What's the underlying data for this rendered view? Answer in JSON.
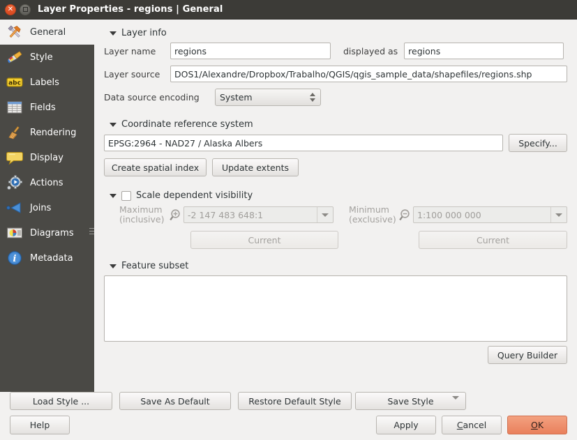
{
  "window": {
    "title": "Layer Properties - regions | General",
    "close_label": "×",
    "maximize_label": "□"
  },
  "sidebar": {
    "items": [
      {
        "label": "General",
        "icon": "tools-icon",
        "active": true
      },
      {
        "label": "Style",
        "icon": "paintbrush-icon",
        "active": false
      },
      {
        "label": "Labels",
        "icon": "abc-label-icon",
        "active": false
      },
      {
        "label": "Fields",
        "icon": "table-icon",
        "active": false
      },
      {
        "label": "Rendering",
        "icon": "broom-icon",
        "active": false
      },
      {
        "label": "Display",
        "icon": "speech-bubble-icon",
        "active": false
      },
      {
        "label": "Actions",
        "icon": "gear-play-icon",
        "active": false
      },
      {
        "label": "Joins",
        "icon": "left-arrow-icon",
        "active": false
      },
      {
        "label": "Diagrams",
        "icon": "pie-chart-icon",
        "active": false
      },
      {
        "label": "Metadata",
        "icon": "info-icon",
        "active": false
      }
    ]
  },
  "layer_info": {
    "section_title": "Layer info",
    "layer_name_label": "Layer name",
    "layer_name_value": "regions",
    "displayed_as_label": "displayed as",
    "displayed_as_value": "regions",
    "layer_source_label": "Layer source",
    "layer_source_value": "DOS1/Alexandre/Dropbox/Trabalho/QGIS/qgis_sample_data/shapefiles/regions.shp",
    "encoding_label": "Data source encoding",
    "encoding_value": "System"
  },
  "crs": {
    "section_title": "Coordinate reference system",
    "value": "EPSG:2964 - NAD27 / Alaska Albers",
    "specify_label": "Specify...",
    "create_index_label": "Create spatial index",
    "update_extents_label": "Update extents"
  },
  "scale_visibility": {
    "section_title": "Scale dependent visibility",
    "checked": false,
    "maximum_label_line1": "Maximum",
    "maximum_label_line2": "(inclusive)",
    "maximum_value": "-2 147 483 648:1",
    "maximum_icon": "zoom-in-icon",
    "minimum_label_line1": "Minimum",
    "minimum_label_line2": "(exclusive)",
    "minimum_value": "1:100 000 000",
    "minimum_icon": "zoom-out-icon",
    "current_max_label": "Current",
    "current_min_label": "Current"
  },
  "feature_subset": {
    "section_title": "Feature subset",
    "value": "",
    "placeholder": "",
    "query_builder_label": "Query Builder"
  },
  "style_buttons": {
    "load_style": "Load Style ...",
    "save_as_default": "Save As Default",
    "restore_default_style": "Restore Default Style",
    "save_style": "Save Style"
  },
  "dialog_buttons": {
    "help": "Help",
    "apply": "Apply",
    "cancel": "Cancel",
    "cancel_mnemonic": "C",
    "ok": "OK",
    "ok_mnemonic": "O"
  },
  "colors": {
    "titlebar_bg": "#3c3b37",
    "sidebar_bg": "#4a4945",
    "panel_bg": "#f2f1f0",
    "ok_accent": "#e9805c",
    "close_accent": "#e0512a"
  }
}
